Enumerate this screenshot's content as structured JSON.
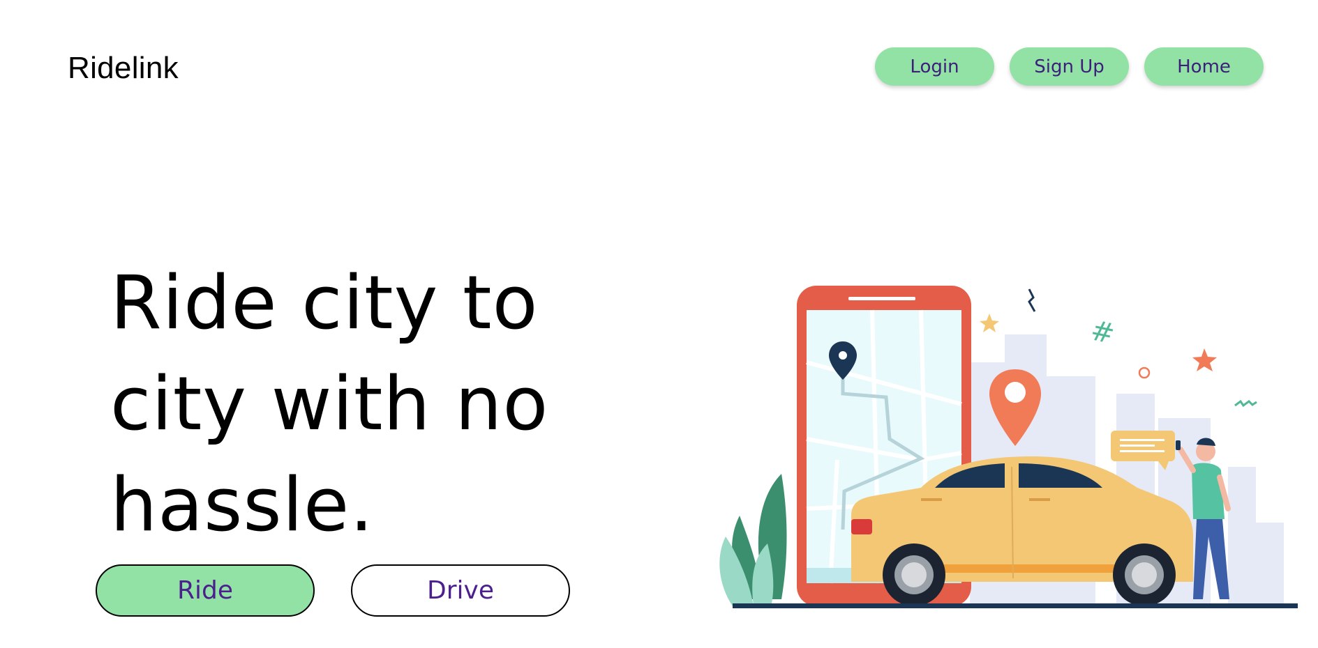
{
  "header": {
    "brand": "Ridelink"
  },
  "nav": {
    "login": "Login",
    "signup": "Sign Up",
    "home": "Home"
  },
  "hero": {
    "headline_line1": "Ride city to",
    "headline_line2": "city with no",
    "headline_line3": "hassle."
  },
  "cta": {
    "ride": "Ride",
    "drive": "Drive"
  },
  "colors": {
    "accent_green": "#93e2a5",
    "button_text_purple": "#3b1f7a",
    "phone_red": "#e45d48",
    "car_yellow": "#f4c775",
    "navy": "#1b3655"
  },
  "illustration": {
    "icons": [
      "phone-icon",
      "map-pin-icon",
      "car-icon",
      "person-icon",
      "chat-bubble-icon",
      "star-icon",
      "hashtag-icon"
    ]
  }
}
